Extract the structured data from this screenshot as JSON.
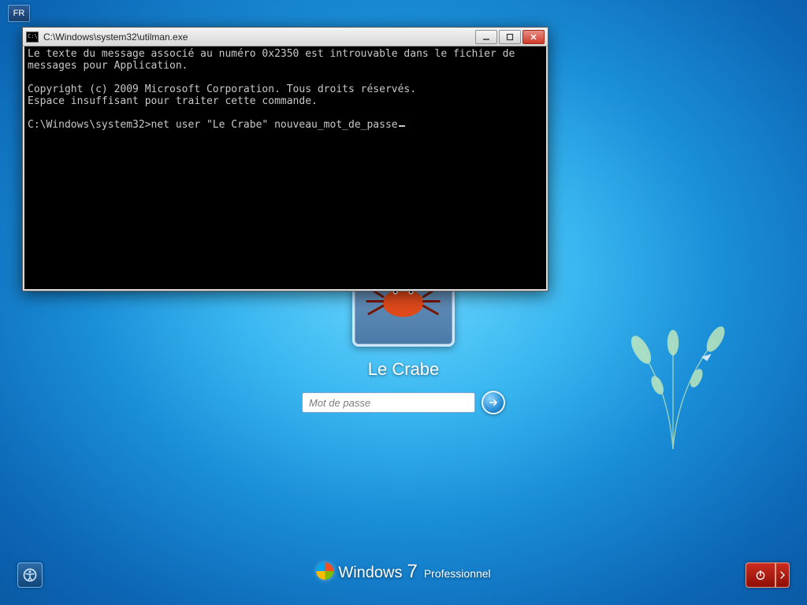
{
  "lang_indicator": "FR",
  "login": {
    "username": "Le Crabe",
    "password_placeholder": "Mot de passe"
  },
  "branding": {
    "product": "Windows",
    "version": "7",
    "edition": "Professionnel"
  },
  "cmd": {
    "title": "C:\\Windows\\system32\\utilman.exe",
    "lines": [
      "Le texte du message associé au numéro 0x2350 est introuvable dans le fichier de",
      "messages pour Application.",
      "",
      "Copyright (c) 2009 Microsoft Corporation. Tous droits réservés.",
      "Espace insuffisant pour traiter cette commande.",
      "",
      "C:\\Windows\\system32>net user \"Le Crabe\" nouveau_mot_de_passe"
    ]
  }
}
